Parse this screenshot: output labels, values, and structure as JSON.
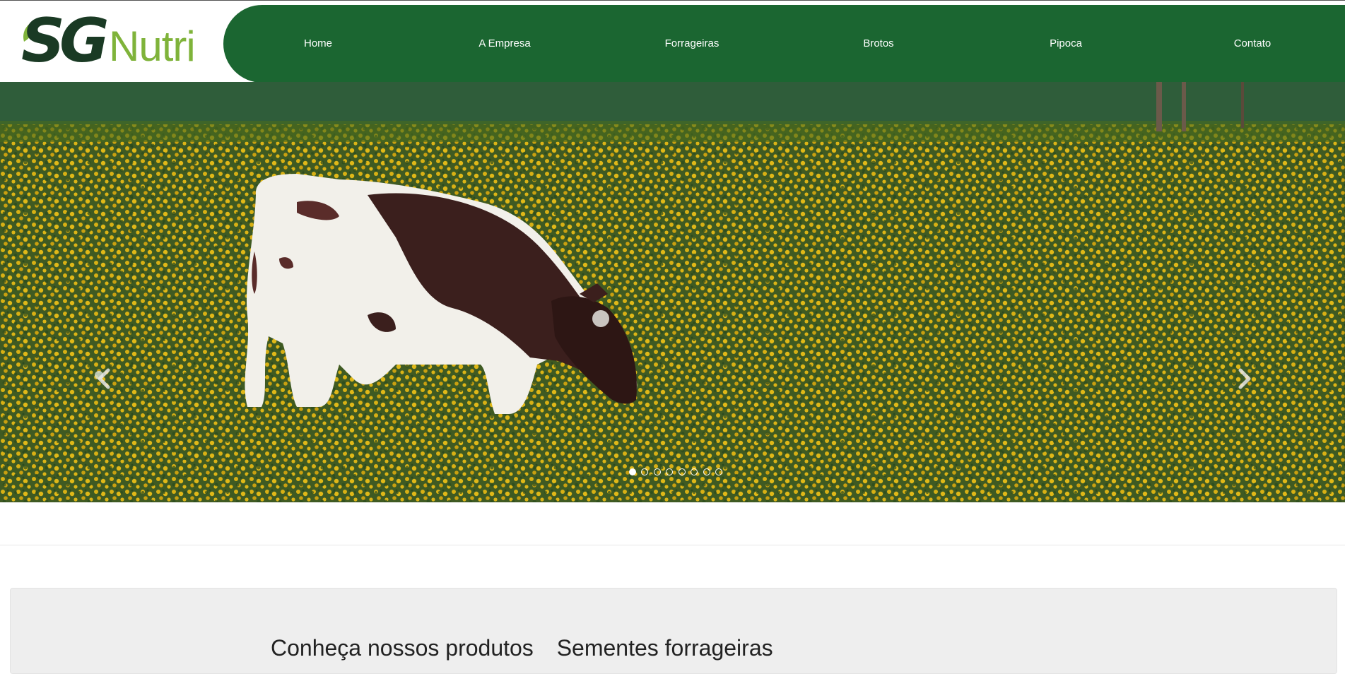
{
  "brand": {
    "logo_sg": "SG",
    "logo_nutri": "Nutri",
    "colors": {
      "primary_green": "#1b6631",
      "logo_dark": "#1a3a24",
      "logo_light": "#7fb33a"
    }
  },
  "nav": {
    "items": [
      {
        "label": "Home"
      },
      {
        "label": "A Empresa"
      },
      {
        "label": "Forrageiras"
      },
      {
        "label": "Brotos"
      },
      {
        "label": "Pipoca"
      },
      {
        "label": "Contato"
      }
    ]
  },
  "carousel": {
    "slide_count": 8,
    "active_index": 0,
    "prev_icon": "chevron-left-icon",
    "next_icon": "chevron-right-icon",
    "image_description_icon": "cow-grazing-photo"
  },
  "section": {
    "heading_part1": "Conheça nossos produtos",
    "heading_part2": "Sementes forrageiras"
  }
}
